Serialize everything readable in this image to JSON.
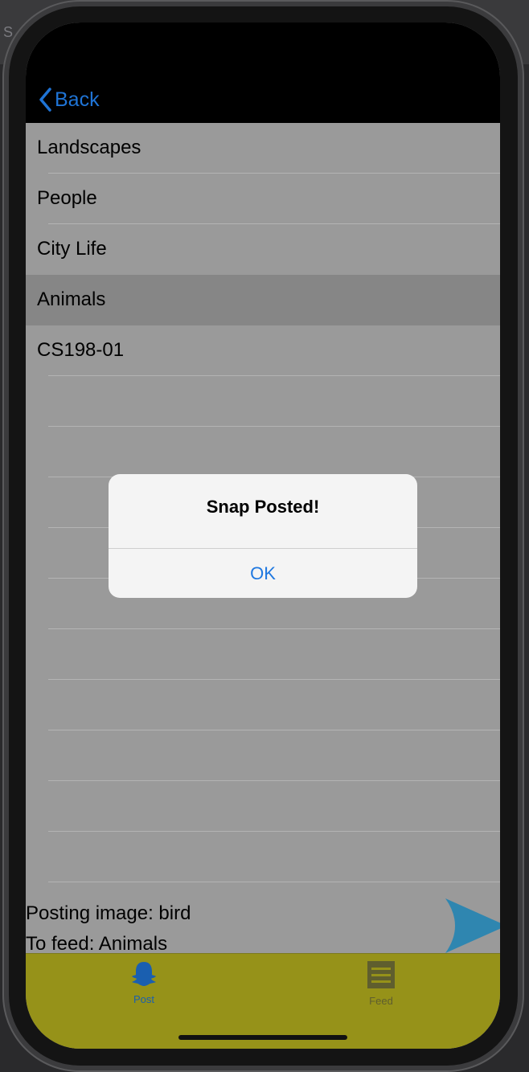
{
  "backdrop": {
    "letter": "S"
  },
  "nav": {
    "back_label": "Back"
  },
  "list": {
    "items": [
      {
        "label": "Landscapes",
        "selected": false
      },
      {
        "label": "People",
        "selected": false
      },
      {
        "label": "City Life",
        "selected": false
      },
      {
        "label": "Animals",
        "selected": true
      },
      {
        "label": "CS198-01",
        "selected": false
      }
    ],
    "empty_rows": 10
  },
  "posting": {
    "image_line": "Posting image: bird",
    "feed_line": "To feed: Animals"
  },
  "alert": {
    "title": "Snap Posted!",
    "ok_label": "OK"
  },
  "tabbar": {
    "tabs": [
      {
        "label": "Post",
        "icon": "ghost-icon",
        "active": true
      },
      {
        "label": "Feed",
        "icon": "list-icon",
        "active": false
      }
    ]
  },
  "colors": {
    "accent": "#1f74d6",
    "tabbar": "#969219",
    "send": "#2f86b0",
    "list_bg": "#9a9a9a",
    "selected_row": "#868686"
  }
}
